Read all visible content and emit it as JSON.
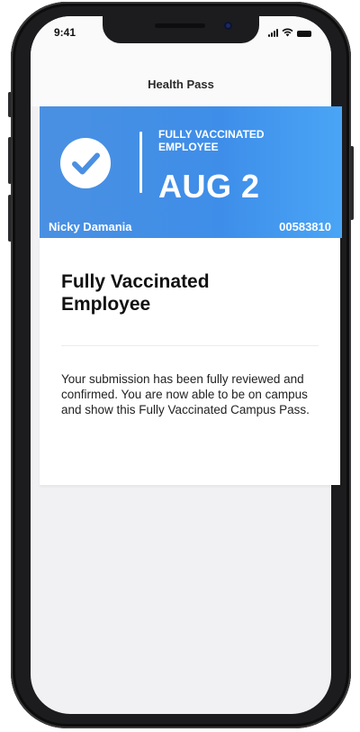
{
  "status_bar": {
    "time": "9:41",
    "icons": [
      "signal-icon",
      "wifi-icon",
      "battery-icon"
    ]
  },
  "nav": {
    "title": "Health Pass"
  },
  "pass_card": {
    "status_label": "FULLY VACCINATED EMPLOYEE",
    "date": "AUG 2",
    "holder_name": "Nicky Damania",
    "holder_id": "00583810",
    "icon": "checkmark-circle-icon",
    "color_start": "#4a90e2",
    "color_end": "#4aa3f5"
  },
  "details": {
    "title": "Fully Vaccinated Employee",
    "body": "Your submission has been fully reviewed and confirmed. You are now able to be on campus and show this Fully Vaccinated Campus Pass."
  }
}
